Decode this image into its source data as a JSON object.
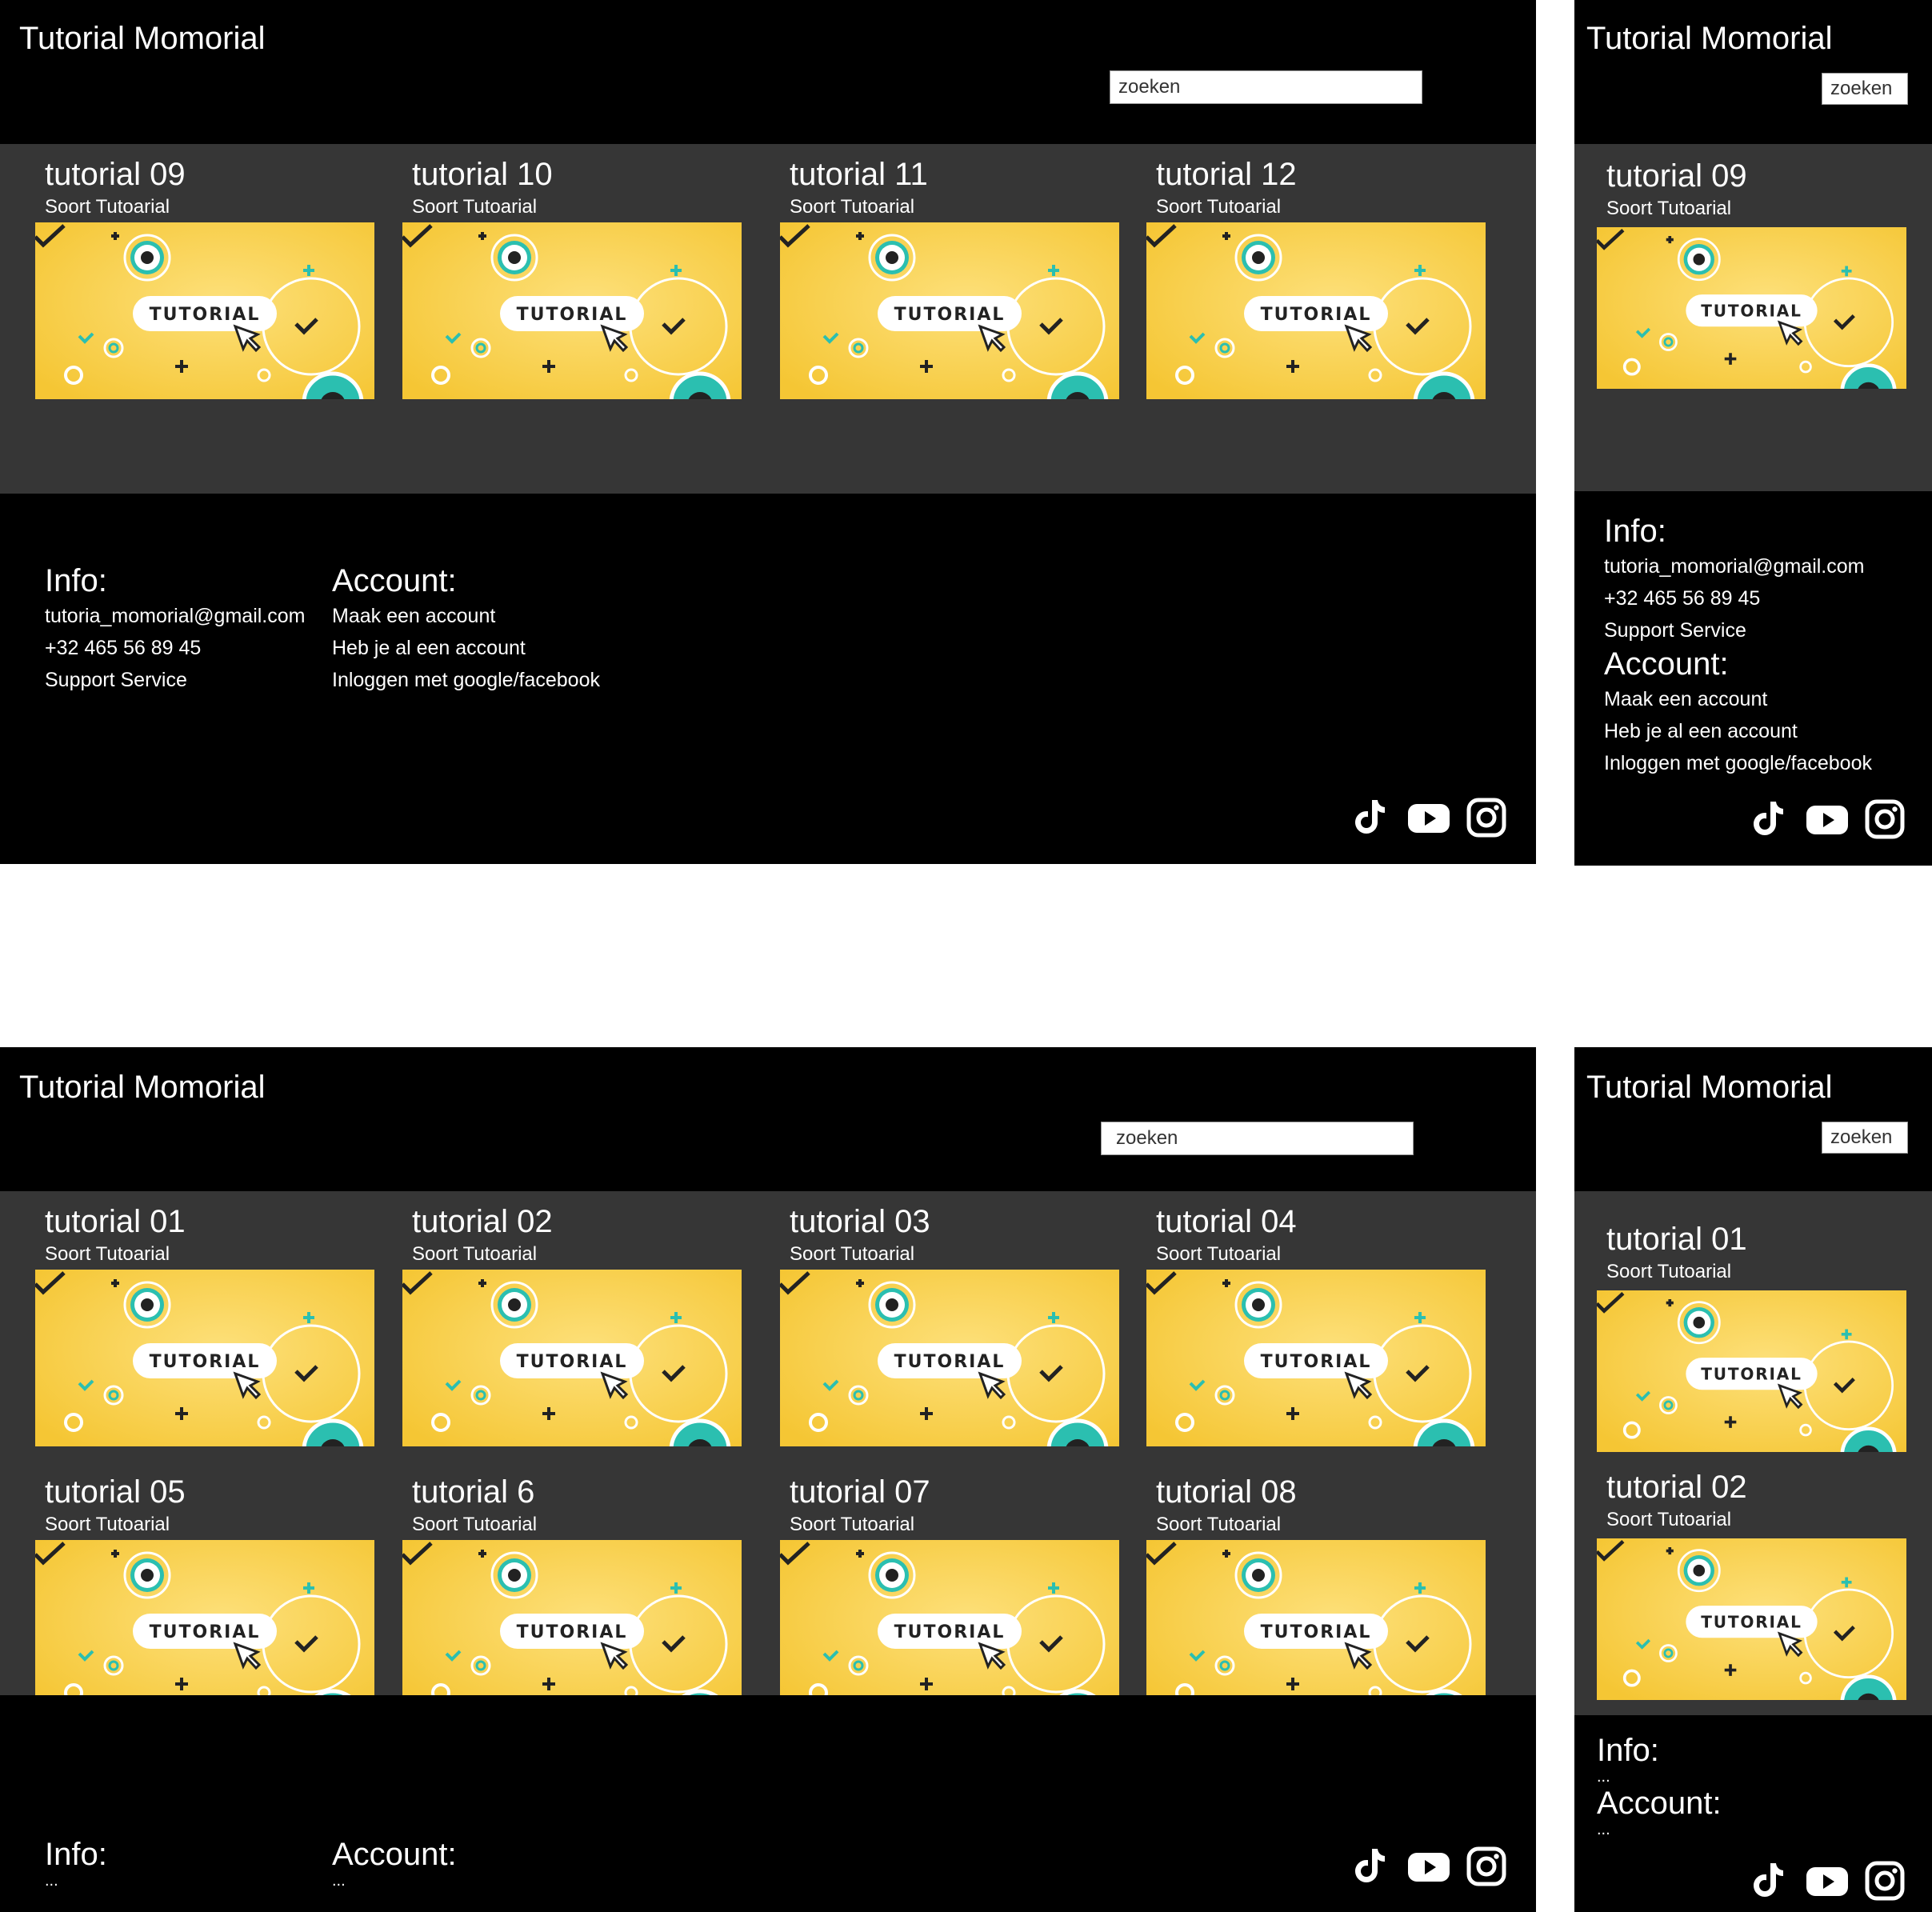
{
  "site_title": "Tutorial Momorial",
  "search_placeholder": "zoeken",
  "card_subtitle": "Soort Tutoarial",
  "thumbnail_text": "TUTORIAL",
  "footer": {
    "info_heading": "Info:",
    "account_heading": "Account:",
    "info_items": [
      "tutoria_momorial@gmail.com",
      "+32 465 56 89 45",
      "Support Service"
    ],
    "account_items": [
      "Maak een account",
      "Heb je al een account",
      "Inloggen met google/facebook"
    ],
    "ellipsis": "..."
  },
  "desktop_top": {
    "cards": [
      "tutorial 09",
      "tutorial 10",
      "tutorial 11",
      "tutorial 12"
    ]
  },
  "mobile_top": {
    "cards": [
      "tutorial 09"
    ]
  },
  "desktop_bottom": {
    "cards": [
      "tutorial 01",
      "tutorial 02",
      "tutorial 03",
      "tutorial 04",
      "tutorial 05",
      "tutorial 6",
      "tutorial 07",
      "tutorial 08"
    ]
  },
  "mobile_bottom": {
    "cards": [
      "tutorial 01",
      "tutorial 02"
    ]
  },
  "social_icons": [
    "tiktok-icon",
    "youtube-icon",
    "instagram-icon"
  ],
  "colors": {
    "header": "#000000",
    "content": "#363636",
    "thumb_yellow": "#f7c93a",
    "thumb_teal": "#2bbfb0"
  }
}
